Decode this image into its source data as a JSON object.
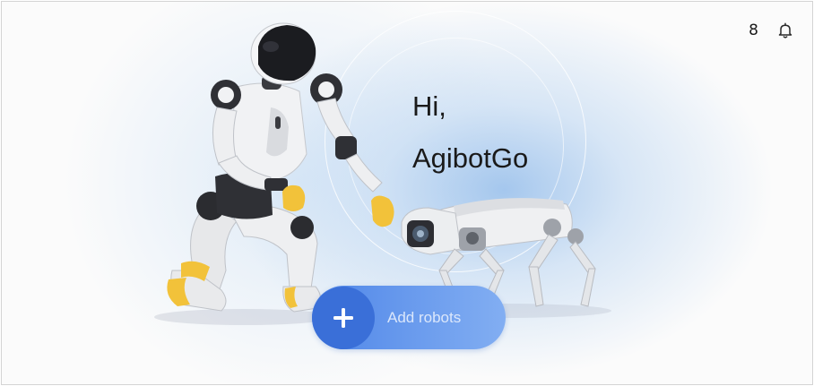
{
  "header": {
    "count": "8",
    "bell_icon": "bell-icon"
  },
  "greeting": {
    "line1": "Hi,",
    "line2": "AgibotGo"
  },
  "add_robots": {
    "label": "Add robots",
    "icon": "plus-icon"
  },
  "colors": {
    "button_primary": "#3a6fd8",
    "button_gradient_end": "#82aef2",
    "background_glow": "#b9d3f2"
  }
}
